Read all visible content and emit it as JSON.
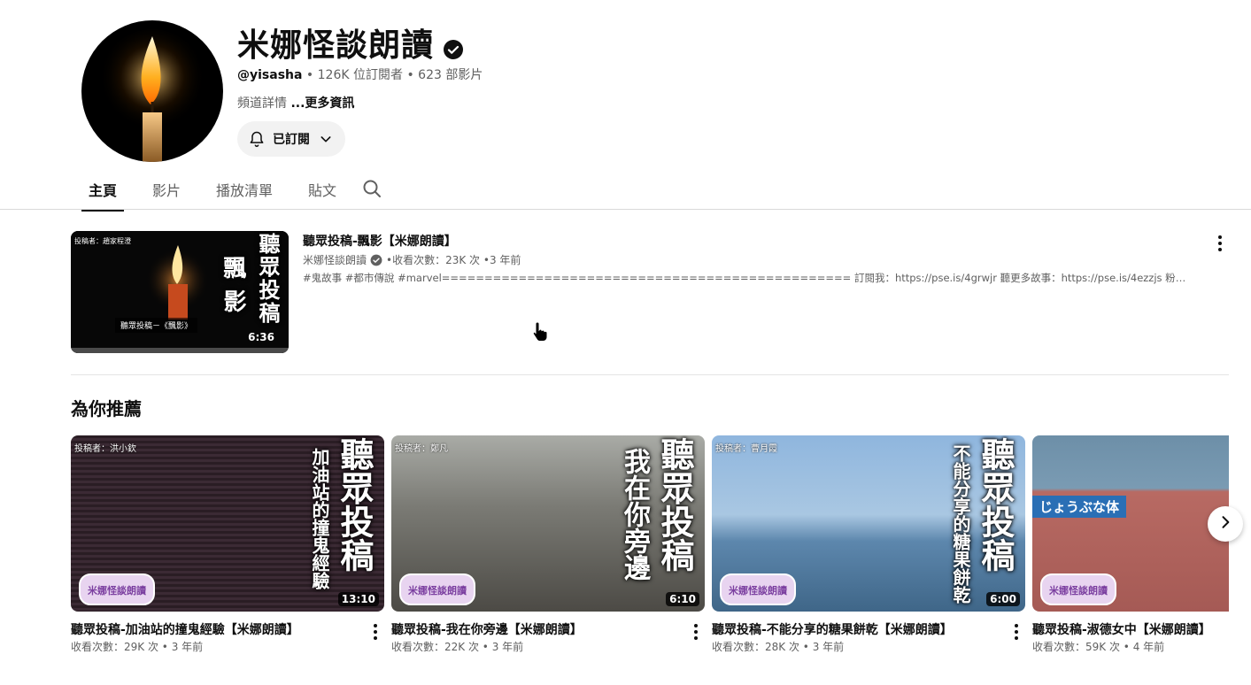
{
  "channel": {
    "name": "米娜怪談朗讀",
    "handle": "@yisasha",
    "subscribers": "126K 位訂閱者",
    "video_count": "623 部影片",
    "desc_prefix": "頻道詳情",
    "more_label": "...更多資訊",
    "subscribe_label": "已訂閱"
  },
  "tabs": [
    {
      "label": "主頁",
      "active": true
    },
    {
      "label": "影片"
    },
    {
      "label": "播放清單"
    },
    {
      "label": "貼文"
    }
  ],
  "featured": {
    "title": "聽眾投稿-飄影【米娜朗讀】",
    "channel": "米娜怪談朗讀",
    "views": "收看次數：23K 次",
    "age": "3 年前",
    "description": "#鬼故事 #都市傳說 #marvel================================================ 訂閱我：https://pse.is/4grwjr 聽更多故事：https://pse.is/4ezzjs 粉絲團頁面：https://www....",
    "duration": "6:36",
    "thumb_text_main": "聽眾投稿",
    "thumb_text_sub": "飄影",
    "thumb_caption": "聽眾投稿－《飄影》",
    "thumb_tag": "投稿者：趙家程澄"
  },
  "shelf": {
    "title": "為你推薦",
    "items": [
      {
        "title": "聽眾投稿-加油站的撞鬼經驗【米娜朗讀】",
        "views": "收看次數：29K 次",
        "age": "3 年前",
        "duration": "13:10",
        "tag": "投稿者：洪小欽",
        "big": "聽眾投稿",
        "sub": "加油站的撞鬼經驗",
        "bg": "#3a2a33"
      },
      {
        "title": "聽眾投稿-我在你旁邊【米娜朗讀】",
        "views": "收看次數：22K 次",
        "age": "3 年前",
        "duration": "6:10",
        "tag": "投稿者：鄭凡",
        "big": "聽眾投稿",
        "sub": "我在你旁邊",
        "bg": "#6d6d68"
      },
      {
        "title": "聽眾投稿-不能分享的糖果餅乾【米娜朗讀】",
        "views": "收看次數：28K 次",
        "age": "3 年前",
        "duration": "6:00",
        "tag": "投稿者：曹月霞",
        "big": "聽眾投稿",
        "sub": "不能分享的糖果餅乾",
        "bg": "#6f9cc7"
      },
      {
        "title": "聽眾投稿-淑德女中【米娜朗讀】",
        "views": "收看次數：59K 次",
        "age": "4 年前",
        "duration": "",
        "tag": "",
        "big": "",
        "sub": "じょうぶな体",
        "bg": "#b86a63"
      }
    ]
  },
  "logo_text": "米娜怪談朗讀",
  "colors": {
    "text": "#0f0f0f",
    "secondary": "#606060",
    "chip_bg": "#f2f2f2"
  }
}
